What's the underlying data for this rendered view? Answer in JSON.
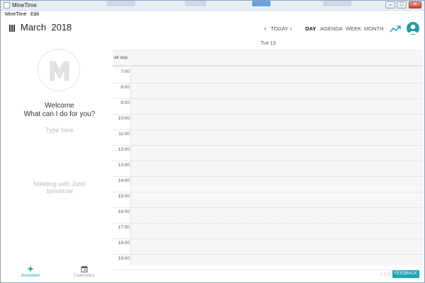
{
  "window": {
    "title": "MineTime"
  },
  "menu": {
    "items": [
      "MineTime",
      "Edit"
    ]
  },
  "header": {
    "month": "March",
    "year": "2018",
    "today_label": "TODAY",
    "views": [
      "DAY",
      "AGENDA",
      "WEEK",
      "MONTH"
    ],
    "active_view": "DAY"
  },
  "assistant": {
    "welcome_line1": "Welcome",
    "welcome_line2": "What can I do for you?",
    "input_placeholder": "Type here",
    "suggestion_line1": "Meeting with John",
    "suggestion_line2": "tomorrow"
  },
  "bottom_tabs": [
    {
      "label": "Assistant",
      "icon": "assistant-icon",
      "active": true
    },
    {
      "label": "Calendars",
      "icon": "calendar-icon",
      "active": false
    }
  ],
  "calendar": {
    "day_header": "Tue 13",
    "allday_label": "all-day",
    "hours": [
      "7:00",
      "8:00",
      "9:00",
      "10:00",
      "11:00",
      "12:00",
      "13:00",
      "14:00",
      "15:00",
      "16:00",
      "17:00",
      "18:00",
      "19:00"
    ]
  },
  "footer": {
    "version": "1.1.4",
    "feedback_label": "FEEDBACK"
  },
  "colors": {
    "accent": "#1aa6b7",
    "avatar": "#1f9ea3"
  }
}
